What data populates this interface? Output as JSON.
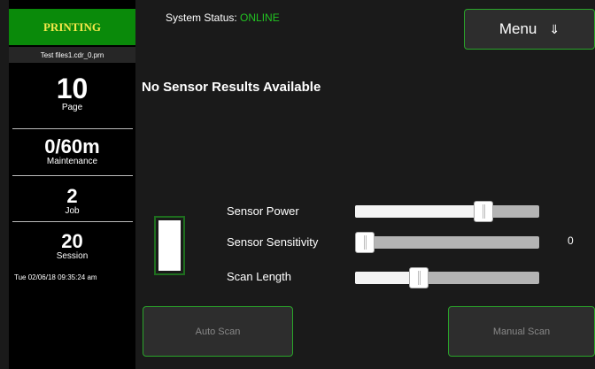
{
  "sidebar": {
    "status_label": "PRINTING",
    "filename": "Test files1.cdr_0.prn",
    "counters": [
      {
        "value": "10",
        "label": "Page"
      },
      {
        "value": "0/60m",
        "label": "Maintenance"
      },
      {
        "value": "2",
        "label": "Job"
      },
      {
        "value": "20",
        "label": "Session"
      }
    ],
    "datetime": "Tue 02/06/18 09:35:24 am"
  },
  "header": {
    "system_status_label": "System Status:",
    "system_status_value": "ONLINE",
    "menu_label": "Menu",
    "menu_icon": "double-arrow-down-icon"
  },
  "main": {
    "no_results": "No Sensor Results Available",
    "sliders": [
      {
        "label": "Sensor Power",
        "value": 0.72
      },
      {
        "label": "Sensor Sensitivity",
        "value": 0.0,
        "display_value": "0"
      },
      {
        "label": "Scan Length",
        "value": 0.33
      }
    ],
    "auto_scan_label": "Auto Scan",
    "manual_scan_label": "Manual Scan"
  },
  "colors": {
    "accent_green": "#2aa52a",
    "status_box_green": "#0a8a0a",
    "status_text_yellow": "#f5e84a",
    "online_green": "#22c322",
    "background": "#1a1a1a"
  }
}
